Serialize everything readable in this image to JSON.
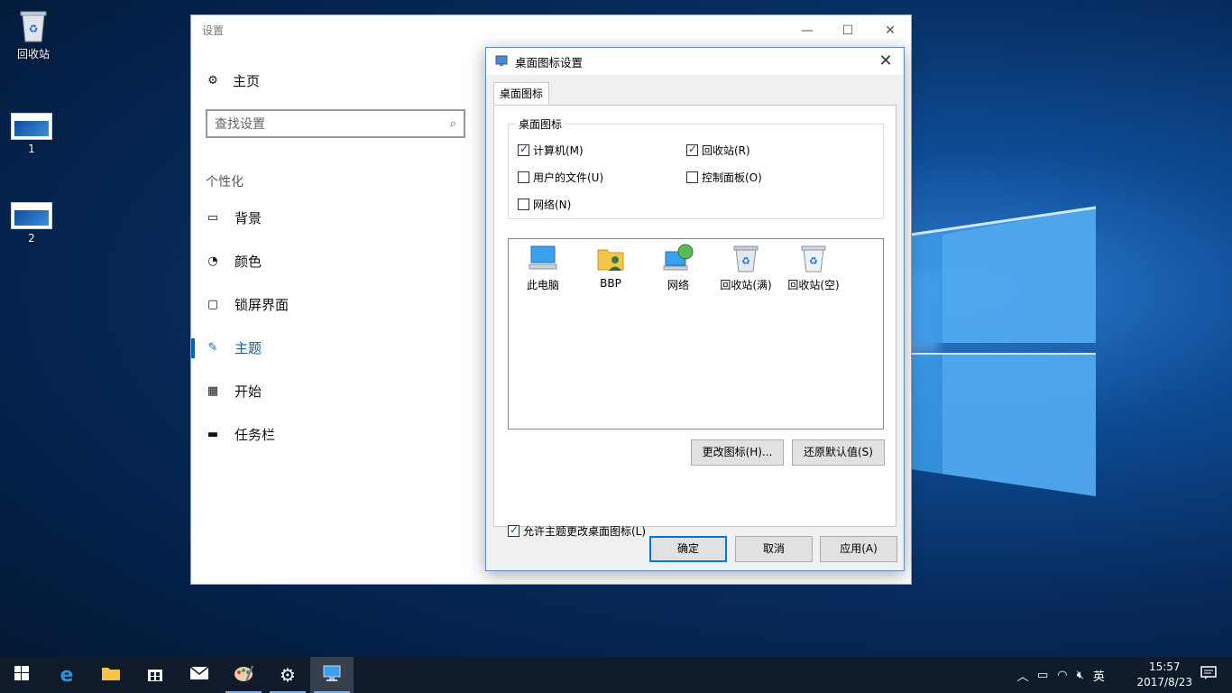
{
  "desktop": {
    "icons": [
      {
        "label": "回收站"
      },
      {
        "label": "1"
      },
      {
        "label": "2"
      }
    ]
  },
  "settings": {
    "window_title": "设置",
    "home_label": "主页",
    "search_placeholder": "查找设置",
    "section_title": "个性化",
    "nav": [
      {
        "label": "背景",
        "icon": "image-icon"
      },
      {
        "label": "颜色",
        "icon": "palette-icon"
      },
      {
        "label": "锁屏界面",
        "icon": "lock-screen-icon"
      },
      {
        "label": "主题",
        "icon": "theme-icon",
        "active": true
      },
      {
        "label": "开始",
        "icon": "start-icon"
      },
      {
        "label": "任务栏",
        "icon": "taskbar-icon"
      }
    ]
  },
  "dialog": {
    "title": "桌面图标设置",
    "tab_label": "桌面图标",
    "group_label": "桌面图标",
    "checkboxes": [
      {
        "label": "计算机(M)",
        "checked": true
      },
      {
        "label": "回收站(R)",
        "checked": true
      },
      {
        "label": "用户的文件(U)",
        "checked": false
      },
      {
        "label": "控制面板(O)",
        "checked": false
      },
      {
        "label": "网络(N)",
        "checked": false
      }
    ],
    "icon_list": [
      {
        "label": "此电脑",
        "icon": "computer-icon"
      },
      {
        "label": "BBP",
        "icon": "user-folder-icon"
      },
      {
        "label": "网络",
        "icon": "network-icon"
      },
      {
        "label": "回收站(满)",
        "icon": "recycle-bin-full-icon"
      },
      {
        "label": "回收站(空)",
        "icon": "recycle-bin-empty-icon"
      }
    ],
    "change_icon_button": "更改图标(H)...",
    "restore_default_button": "还原默认值(S)",
    "allow_theme_checkbox": {
      "label": "允许主题更改桌面图标(L)",
      "checked": true
    },
    "ok_button": "确定",
    "cancel_button": "取消",
    "apply_button": "应用(A)"
  },
  "taskbar": {
    "apps": [
      "start-icon",
      "edge-icon",
      "file-explorer-icon",
      "store-icon",
      "mail-icon",
      "paint-icon",
      "settings-icon",
      "desktop-icon-settings-icon"
    ],
    "tray": {
      "ime_label": "英",
      "time": "15:57",
      "date": "2017/8/23"
    }
  },
  "colors": {
    "accent": "#0063b1",
    "taskbar": "#0f1a2a"
  }
}
